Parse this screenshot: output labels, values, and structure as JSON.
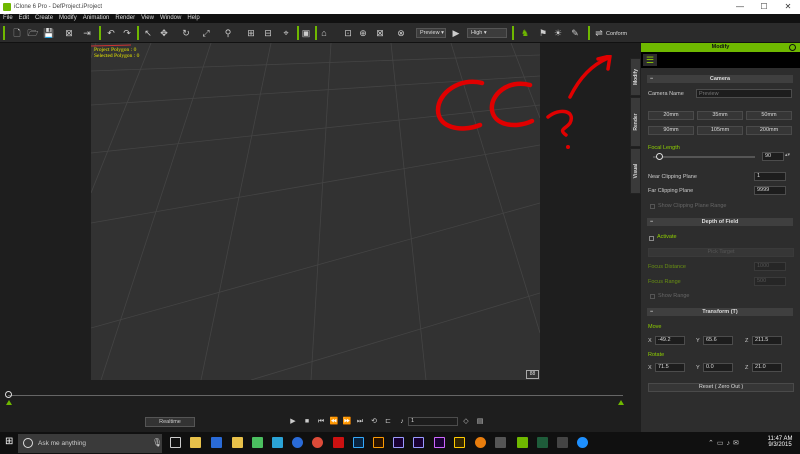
{
  "window": {
    "title": "iClone 6 Pro - DefProject.iProject",
    "minimize": "—",
    "maximize": "☐",
    "close": "✕"
  },
  "menu": [
    "File",
    "Edit",
    "Create",
    "Modify",
    "Animation",
    "Render",
    "View",
    "Window",
    "Help"
  ],
  "toolbar": {
    "preview_label": "Preview",
    "quality_label": "High",
    "conform_label": "Conform"
  },
  "viewport": {
    "stats": [
      "Project Polygon : 0",
      "Selected Polygon : 0"
    ],
    "label": "88",
    "annotation": "CC ?",
    "annotation_color": "#e00000"
  },
  "timeline": {
    "realtime_label": "Realtime",
    "frame_value": "1"
  },
  "panel": {
    "header": "Modify",
    "tabs": [
      "Modify",
      "Render",
      "Visual"
    ],
    "camera": {
      "section": "Camera",
      "camera_name_label": "Camera Name",
      "camera_name_placeholder": "Preview",
      "lens_buttons": [
        "20mm",
        "35mm",
        "50mm",
        "90mm",
        "105mm",
        "200mm"
      ],
      "focal_length_label": "Focal Length",
      "focal_length_value": "90",
      "focal_slider_fraction": 0.06,
      "near_clip_label": "Near Clipping Plane",
      "near_clip_value": "1",
      "far_clip_label": "Far Clipping Plane",
      "far_clip_value": "9999",
      "show_clip_label": "Show Clipping Plane Range"
    },
    "dof": {
      "section": "Depth of Field",
      "activate_label": "Activate",
      "pick_target_label": "Pick Target",
      "focus_distance_label": "Focus Distance",
      "focus_distance_value": "1000",
      "focus_range_label": "Focus Range",
      "focus_range_value": "500",
      "show_range_label": "Show Range"
    },
    "transform": {
      "section": "Transform  (T)",
      "move_label": "Move",
      "move": {
        "x": "-49.2",
        "y": "65.6",
        "z": "211.5"
      },
      "rotate_label": "Rotate",
      "rotate": {
        "x": "71.5",
        "y": "0.0",
        "z": "21.0"
      },
      "reset_label": "Reset ( Zero Out )"
    }
  },
  "taskbar": {
    "search_placeholder": "Ask me anything",
    "clock_time": "11:47 AM",
    "clock_date": "9/3/2015"
  },
  "colors": {
    "accent": "#6fb800",
    "stats_text": "#e6e600"
  }
}
